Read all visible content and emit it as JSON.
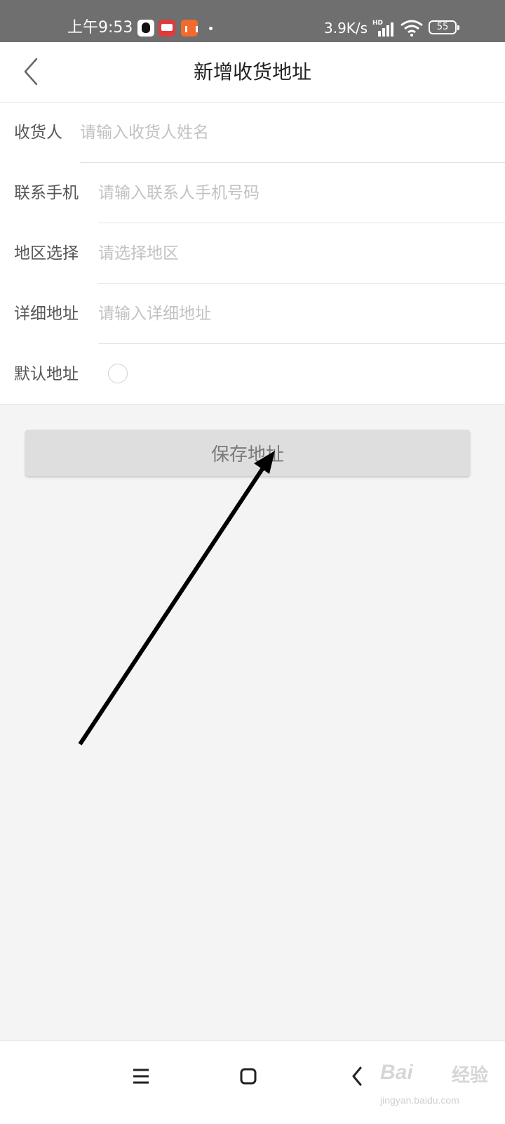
{
  "status_bar": {
    "time": "上午9:53",
    "network_speed": "3.9K/s",
    "signal_label": "HD",
    "battery": "55"
  },
  "header": {
    "title": "新增收货地址"
  },
  "form": {
    "receiver": {
      "label": "收货人",
      "placeholder": "请输入收货人姓名"
    },
    "phone": {
      "label": "联系手机",
      "placeholder": "请输入联系人手机号码"
    },
    "region": {
      "label": "地区选择",
      "placeholder": "请选择地区"
    },
    "detail": {
      "label": "详细地址",
      "placeholder": "请输入详细地址"
    },
    "default": {
      "label": "默认地址",
      "checked": false
    }
  },
  "save_button": {
    "label": "保存地址"
  },
  "watermark": {
    "brand": "Bai",
    "brand_cn": "经验",
    "url": "jingyan.baidu.com"
  },
  "colors": {
    "status_bar_bg": "#6f6f6f",
    "page_bg": "#f4f4f4",
    "button_bg": "#dedede",
    "button_text": "#7a7a7a",
    "placeholder": "#c2c2c2"
  },
  "icons": [
    "back-chevron-icon",
    "qq-icon",
    "toutiao-icon",
    "app-icon",
    "signal-icon",
    "wifi-icon",
    "battery-icon",
    "menu-icon",
    "home-icon",
    "back-icon",
    "arrow-annotation"
  ]
}
